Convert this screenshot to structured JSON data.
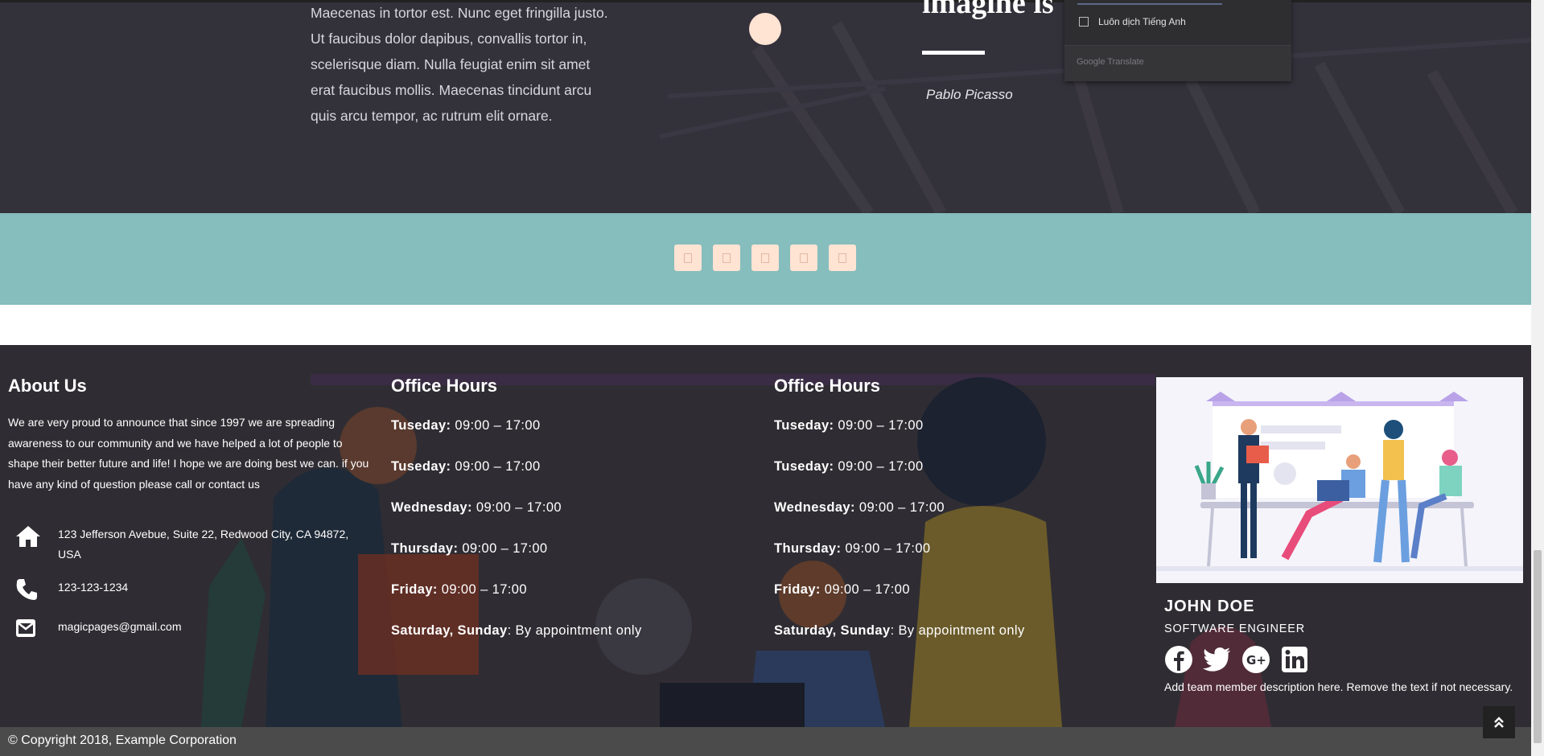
{
  "hero": {
    "paragraph": "Maecenas in tortor est. Nunc eget fringilla justo. Ut faucibus dolor dapibus, convallis tortor in, scelerisque diam. Nulla feugiat enim sit amet erat faucibus mollis. Maecenas tincidunt arcu quis arcu tempor, ac rutrum elit ornare.",
    "quote_title": "imagine is",
    "quote_author": "Pablo Picasso"
  },
  "translate": {
    "always_label": "Luôn dịch Tiếng Anh",
    "brand": "Google Translate"
  },
  "band": {
    "icons": [
      "icon-1",
      "icon-2",
      "icon-3",
      "icon-4",
      "icon-5"
    ]
  },
  "about": {
    "title": "About Us",
    "text": "We are very proud to announce that since 1997 we are spreading awareness to our community and we have helped a lot of people to shape their better future and life! I hope we are doing best we can. if you have any kind of question please call or contact us",
    "address": "123 Jefferson Avebue, Suite 22, Redwood City, CA 94872, USA",
    "phone": "123-123-1234",
    "email": "magicpages@gmail.com"
  },
  "hours_1": {
    "title": "Office Hours",
    "rows": [
      {
        "day": "Tuseday:",
        "time": " 09:00 – 17:00"
      },
      {
        "day": "Tuseday:",
        "time": " 09:00 – 17:00"
      },
      {
        "day": "Wednesday:",
        "time": " 09:00 – 17:00"
      },
      {
        "day": "Thursday:",
        "time": " 09:00 – 17:00"
      },
      {
        "day": "Friday:",
        "time": " 09:00 – 17:00"
      },
      {
        "day": "Saturday, Sunday",
        "time": ": By appointment only"
      }
    ]
  },
  "hours_2": {
    "title": "Office Hours",
    "rows": [
      {
        "day": "Tuseday:",
        "time": " 09:00 – 17:00"
      },
      {
        "day": "Tuseday:",
        "time": " 09:00 – 17:00"
      },
      {
        "day": "Wednesday:",
        "time": " 09:00 – 17:00"
      },
      {
        "day": "Thursday:",
        "time": " 09:00 – 17:00"
      },
      {
        "day": "Friday:",
        "time": " 09:00 – 17:00"
      },
      {
        "day": "Saturday, Sunday",
        "time": ": By appointment only"
      }
    ]
  },
  "team": {
    "name": "JOHN DOE",
    "role": "SOFTWARE ENGINEER",
    "description": "Add team member description here. Remove the text if not necessary.",
    "social": [
      "facebook-icon",
      "twitter-icon",
      "google-plus-icon",
      "linkedin-icon"
    ]
  },
  "copyright": "© Copyright 2018, Example Corporation",
  "colors": {
    "hero_bg": "#33313a",
    "band": "#86bdbd",
    "accent_peach": "#ffe3d3",
    "footer_bg": "#2f2d33",
    "copyright_bg": "#4b4b4b"
  }
}
